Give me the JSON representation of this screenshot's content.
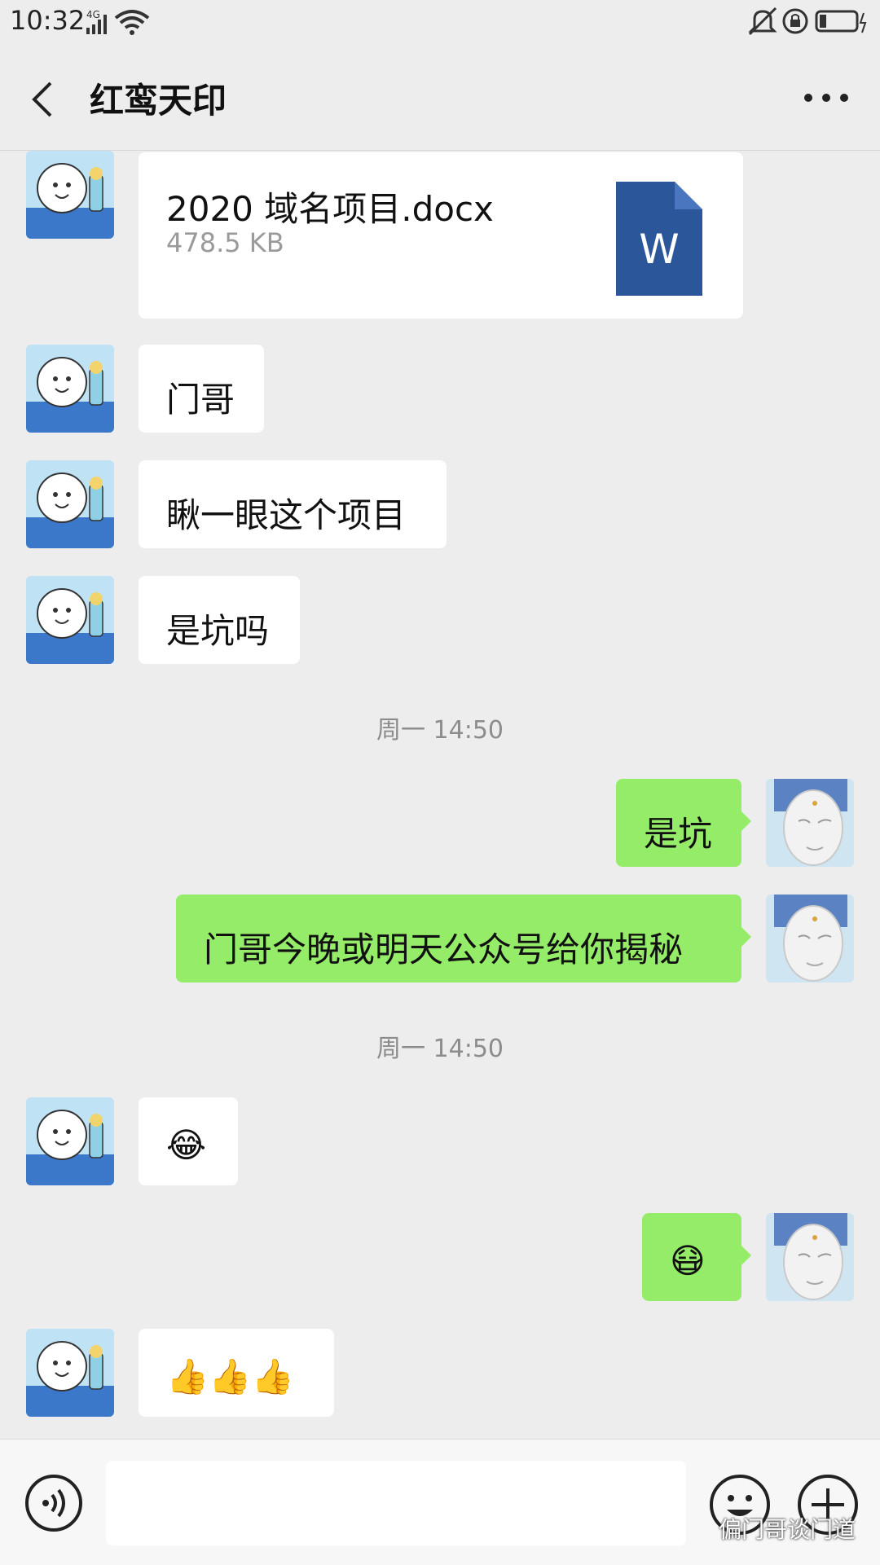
{
  "status": {
    "time": "10:32",
    "network": "4G"
  },
  "header": {
    "title": "红鸾天印"
  },
  "file": {
    "name": "2020 域名项目.docx",
    "size": "478.5 KB",
    "icon_letter": "W"
  },
  "messages": [
    {
      "side": "in",
      "text": "门哥"
    },
    {
      "side": "in",
      "text": "瞅一眼这个项目"
    },
    {
      "side": "in",
      "text": "是坑吗"
    },
    {
      "side": "out",
      "text": "是坑"
    },
    {
      "side": "out",
      "text": "门哥今晚或明天公众号给你揭秘"
    },
    {
      "side": "in",
      "text": "😂"
    },
    {
      "side": "out",
      "text": "😷"
    },
    {
      "side": "in",
      "text": "👍👍👍"
    }
  ],
  "timestamps": [
    "周一 14:50",
    "周一 14:50"
  ],
  "watermark": "偏门哥谈门道",
  "colors": {
    "background": "#ededed",
    "bubble_out": "#95ec69",
    "bubble_in": "#ffffff",
    "word_blue": "#2b579a"
  },
  "icons": [
    "back-arrow-icon",
    "more-icon",
    "voice-icon",
    "emoji-icon",
    "plus-icon",
    "word-file-icon"
  ]
}
